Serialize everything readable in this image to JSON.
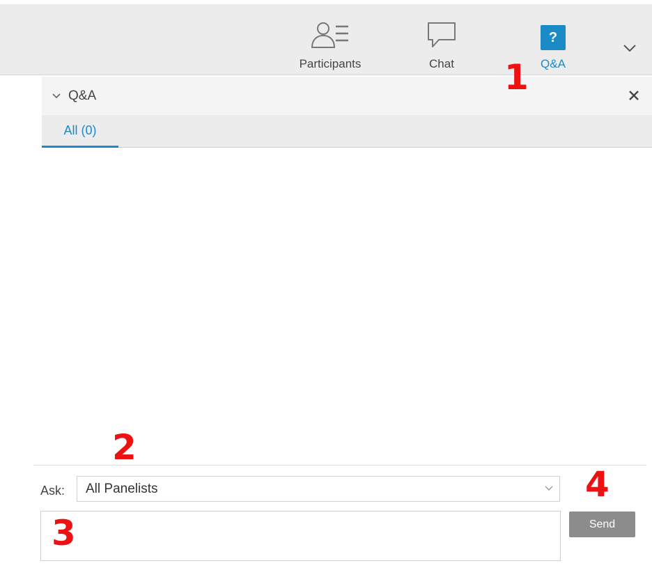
{
  "toolbar": {
    "participants_label": "Participants",
    "participants_icon": "participants-list-icon",
    "chat_label": "Chat",
    "chat_icon": "chat-bubble-icon",
    "qa_label": "Q&A",
    "qa_icon_glyph": "?",
    "more_icon": "chevron-down-icon"
  },
  "panel": {
    "title": "Q&A",
    "collapse_icon": "chevron-down-icon",
    "close_icon": "close-icon"
  },
  "tabs": [
    {
      "label": "All (0)",
      "active": true
    }
  ],
  "ask": {
    "label": "Ask:",
    "selected": "All Panelists"
  },
  "question_input": {
    "value": ""
  },
  "send_label": "Send",
  "markers": [
    "1",
    "2",
    "3",
    "4"
  ],
  "colors": {
    "accent": "#1a8bc6",
    "marker": "#ee1111",
    "send_button": "#8c8c8c"
  }
}
